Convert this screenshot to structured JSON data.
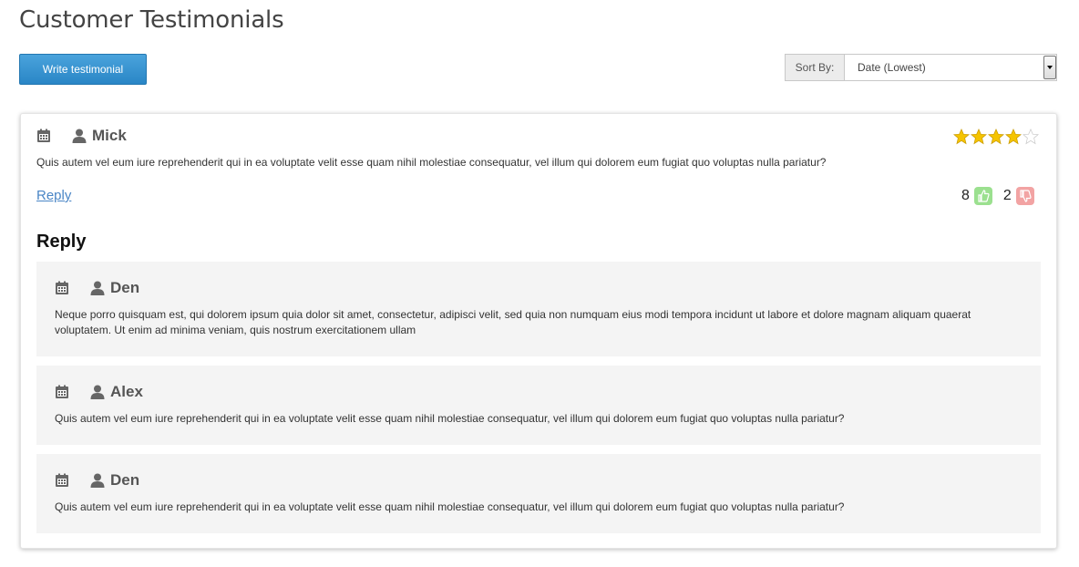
{
  "page": {
    "title": "Customer Testimonials"
  },
  "toolbar": {
    "write_label": "Write testimonial",
    "sort_label": "Sort By:",
    "sort_value": "Date (Lowest)"
  },
  "testimonial": {
    "author": "Mick",
    "text": "Quis autem vel eum iure reprehenderit qui in ea voluptate velit esse quam nihil molestiae consequatur, vel illum qui dolorem eum fugiat quo voluptas nulla pariatur?",
    "reply_link": "Reply",
    "rating": 4,
    "rating_max": 5,
    "likes": "8",
    "dislikes": "2",
    "icons": {
      "date": "calendar-icon",
      "author": "user-icon",
      "like": "thumbs-up-icon",
      "dislike": "thumbs-down-icon"
    },
    "colors": {
      "star": "#f5c400",
      "link": "#4a86c6",
      "like_bg": "#9be08f",
      "dislike_bg": "#f2a3a3",
      "button": "#2a86c6"
    }
  },
  "replies_section": {
    "heading": "Reply",
    "items": [
      {
        "author": "Den",
        "text": "Neque porro quisquam est, qui dolorem ipsum quia dolor sit amet, consectetur, adipisci velit, sed quia non numquam eius modi tempora incidunt ut labore et dolore magnam aliquam quaerat voluptatem. Ut enim ad minima veniam, quis nostrum exercitationem ullam"
      },
      {
        "author": "Alex",
        "text": "Quis autem vel eum iure reprehenderit qui in ea voluptate velit esse quam nihil molestiae consequatur, vel illum qui dolorem eum fugiat quo voluptas nulla pariatur?"
      },
      {
        "author": "Den",
        "text": "Quis autem vel eum iure reprehenderit qui in ea voluptate velit esse quam nihil molestiae consequatur, vel illum qui dolorem eum fugiat quo voluptas nulla pariatur?"
      }
    ]
  }
}
